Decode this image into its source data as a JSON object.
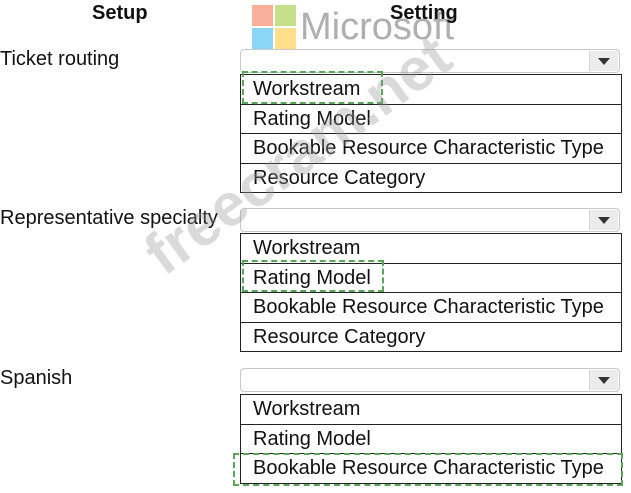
{
  "headers": {
    "setup": "Setup",
    "setting": "Setting"
  },
  "watermark": {
    "logo_text": "Microsoft",
    "site_text": "freecram.net"
  },
  "rows": [
    {
      "label": "Ticket routing",
      "options": [
        "Workstream",
        "Rating Model",
        "Bookable Resource Characteristic Type",
        "Resource Category"
      ],
      "selected": "Workstream"
    },
    {
      "label": "Representative specialty",
      "options": [
        "Workstream",
        "Rating Model",
        "Bookable Resource Characteristic Type",
        "Resource Category"
      ],
      "selected": "Rating Model"
    },
    {
      "label": "Spanish",
      "options": [
        "Workstream",
        "Rating Model",
        "Bookable Resource Characteristic Type"
      ],
      "selected": "Bookable Resource Characteristic Type"
    }
  ],
  "colors": {
    "selection_outline": "#5aa55a",
    "logo": [
      "#f25022",
      "#7fba00",
      "#00a4ef",
      "#ffb900"
    ]
  }
}
